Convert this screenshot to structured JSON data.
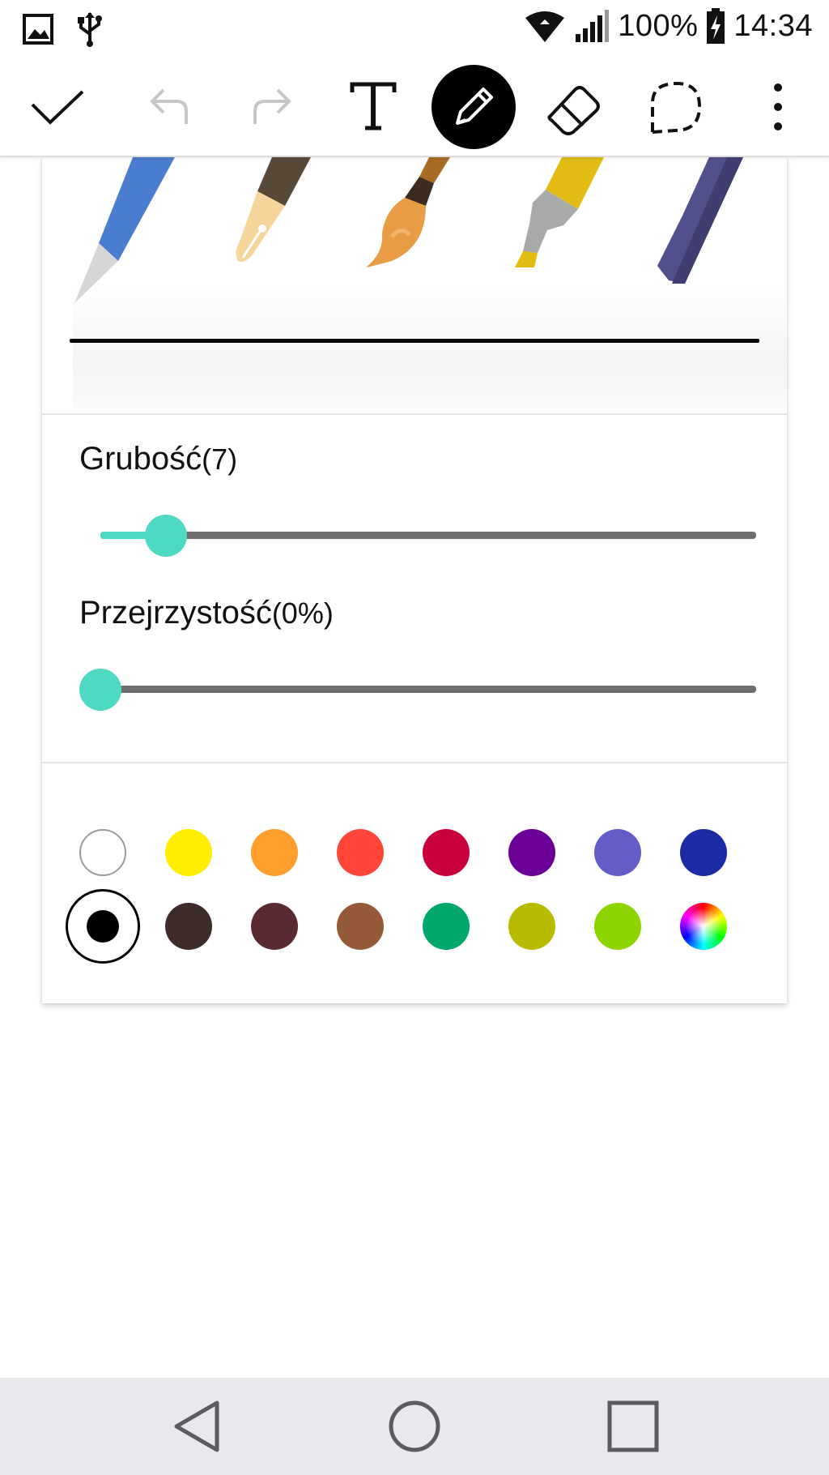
{
  "status_bar": {
    "battery": "100%",
    "time": "14:34",
    "icons": [
      "gallery-icon",
      "usb-icon",
      "wifi-icon",
      "signal-icon",
      "battery-charging-icon"
    ]
  },
  "toolbar": {
    "buttons": [
      "done-check-icon",
      "undo-icon",
      "redo-icon",
      "text-tool-icon",
      "pen-tool-icon",
      "eraser-icon",
      "lasso-select-icon",
      "more-options-icon"
    ],
    "active": "pen-tool-icon"
  },
  "pen_panel": {
    "pen_types": [
      "pencil",
      "fountain-pen",
      "brush",
      "highlighter",
      "marker"
    ],
    "thickness_label": "Grubość",
    "thickness_value": "(7)",
    "thickness_fraction": 0.1,
    "opacity_label": "Przejrzystość",
    "opacity_value": "(0%)",
    "opacity_fraction": 0,
    "colors_row1": [
      "#ffffff",
      "#ffee00",
      "#ff9f2e",
      "#ff4438",
      "#c8003c",
      "#6c0096",
      "#645cc8",
      "#1c2aa4"
    ],
    "colors_row2": [
      "#000000",
      "#3e2c2a",
      "#5a2a32",
      "#955a38",
      "#00a86b",
      "#b8bc00",
      "#8ed400",
      "spectrum"
    ],
    "selected_color": "#000000"
  },
  "nav_bar": {
    "buttons": [
      "back-icon",
      "home-icon",
      "recent-apps-icon"
    ]
  }
}
